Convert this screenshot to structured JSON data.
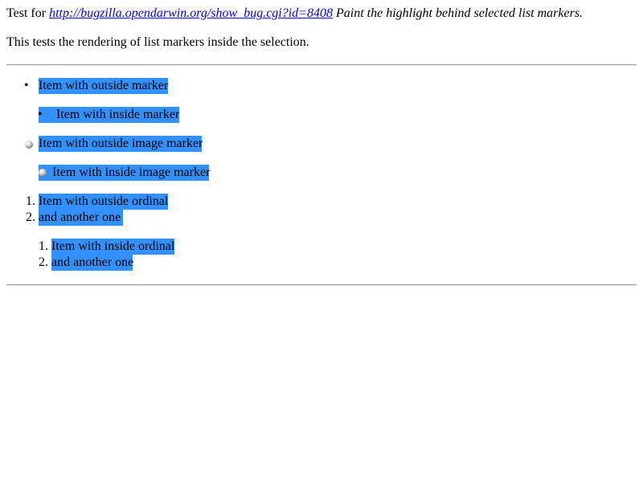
{
  "intro": {
    "prefix": "Test for ",
    "link_text": "http://bugzilla.opendarwin.org/show_bug.cgi?id=8408",
    "suffix": " Paint the highlight behind selected list markers."
  },
  "description": "This tests the rendering of list markers inside the selection.",
  "colors": {
    "selection": "#3390ff",
    "link": "#0000ee"
  },
  "lists": {
    "outside_marker": {
      "bullet": "•",
      "text": "Item with outside marker"
    },
    "inside_marker": {
      "bullet": "•",
      "text": "Item with inside marker"
    },
    "outside_image": {
      "icon": "sphere-bullet-icon",
      "text": "Item with outside image marker"
    },
    "inside_image": {
      "icon": "sphere-bullet-icon",
      "text": "Item with inside image marker"
    },
    "outside_ordinal": [
      {
        "number": "1.",
        "text": "Item with outside ordinal"
      },
      {
        "number": "2.",
        "text": "and another one"
      }
    ],
    "inside_ordinal": [
      {
        "number": "1.",
        "text": "Item with inside ordinal"
      },
      {
        "number": "2.",
        "text": "and another one"
      }
    ]
  }
}
